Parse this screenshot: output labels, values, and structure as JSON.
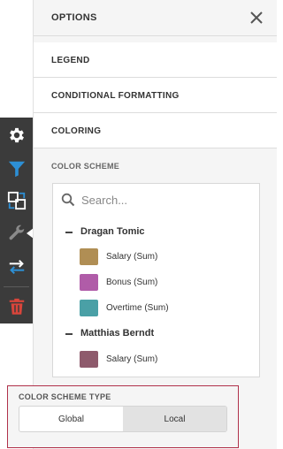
{
  "panel": {
    "title": "OPTIONS",
    "sections": [
      "LEGEND",
      "CONDITIONAL FORMATTING",
      "COLORING"
    ]
  },
  "color_scheme": {
    "heading": "COLOR SCHEME",
    "search_placeholder": "Search...",
    "groups": [
      {
        "name": "Dragan Tomic",
        "items": [
          {
            "label": "Salary (Sum)",
            "color": "#b08e54"
          },
          {
            "label": "Bonus (Sum)",
            "color": "#b05ca8"
          },
          {
            "label": "Overtime (Sum)",
            "color": "#4aa0a6"
          }
        ]
      },
      {
        "name": "Matthias Berndt",
        "items": [
          {
            "label": "Salary (Sum)",
            "color": "#8e5a6c"
          }
        ]
      }
    ]
  },
  "color_scheme_type": {
    "heading": "COLOR SCHEME TYPE",
    "options": [
      "Global",
      "Local"
    ],
    "selected": "Local"
  },
  "toolbar": {
    "icons": [
      "gear-icon",
      "filter-icon",
      "interactivity-icon",
      "wrench-icon",
      "convert-icon",
      "trash-icon"
    ],
    "colors": {
      "dark": "#3b3b3b",
      "blue": "#2d8fd5",
      "red": "#d9453b",
      "white": "#ffffff"
    }
  },
  "accent": {
    "highlight_border": "#b0314a"
  }
}
